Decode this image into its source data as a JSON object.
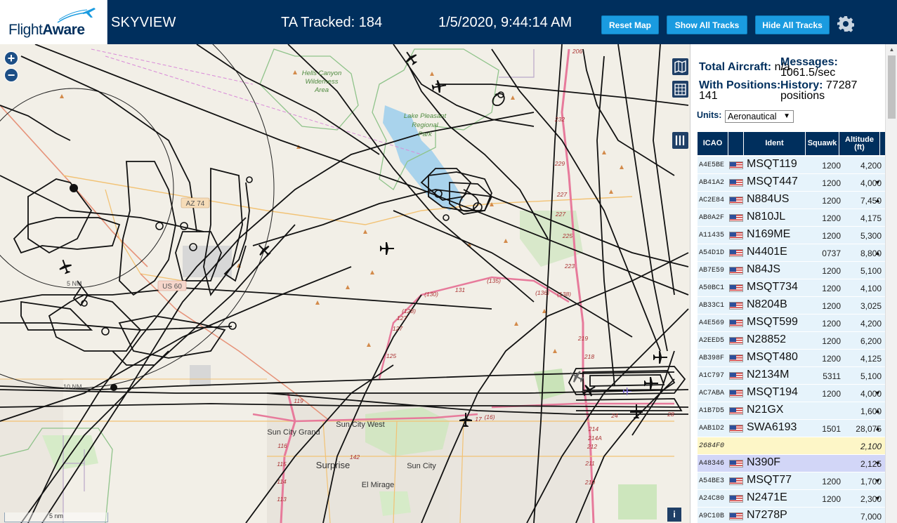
{
  "header": {
    "logo_flight": "Flight",
    "logo_aware": "Aware",
    "title": "SKYVIEW",
    "tracked": "TA Tracked: 184",
    "datetime": "1/5/2020, 9:44:14 AM",
    "buttons": {
      "reset": "Reset Map",
      "show_all": "Show All Tracks",
      "hide_all": "Hide All Tracks"
    },
    "colors": {
      "bar": "#002f5d",
      "button": "#1a9be0"
    }
  },
  "map": {
    "zoom_in": "+",
    "zoom_out": "−",
    "scale_label": "5 nm",
    "info": "i",
    "labels": {
      "hells_canyon_1": "Hells Canyon",
      "hells_canyon_2": "Wilderness",
      "hells_canyon_3": "Area",
      "lake_1": "Lake Pleasant",
      "lake_2": "Regional",
      "lake_3": "Park",
      "az74": "AZ 74",
      "us60": "US 60",
      "ring_5nm": "5 NM",
      "ring_10nm": "10 NM",
      "sun_city_grand": "Sun City Grand",
      "sun_city_west": "Sun City West",
      "sun_city": "Sun City",
      "surprise": "Surprise",
      "el_mirage": "El Mirage"
    },
    "route_markers": [
      "206",
      "232",
      "229",
      "227",
      "227",
      "225",
      "223",
      "219",
      "218",
      "214",
      "214A",
      "212",
      "211",
      "210",
      "116",
      "115",
      "114",
      "113",
      "119",
      "125",
      "127",
      "127",
      "(128)",
      "(130)",
      "131",
      "(135)",
      "(136)",
      "(138)",
      "142",
      "17",
      "(16)",
      "24",
      "28"
    ]
  },
  "panel": {
    "total_aircraft_label": "Total Aircraft:",
    "total_aircraft_value": "n/a",
    "with_positions_label": "With Positions:",
    "with_positions_value": "141",
    "messages_label": "Messages:",
    "messages_value": "1061.5/sec",
    "history_label": "History:",
    "history_value": "77287 positions",
    "units_label": "Units:",
    "units_value": "Aeronautical",
    "columns": {
      "icao": "ICAO",
      "ident": "Ident",
      "squawk": "Squawk",
      "altitude": "Altitude (ft)"
    },
    "rows": [
      {
        "icao": "A4E5BE",
        "ident": "MSQT119",
        "squawk": "1200",
        "alt": "4,200",
        "trend": "",
        "flag": true,
        "style": ""
      },
      {
        "icao": "AB41A2",
        "ident": "MSQT447",
        "squawk": "1200",
        "alt": "4,000",
        "trend": "▼",
        "flag": true,
        "style": ""
      },
      {
        "icao": "AC2E84",
        "ident": "N884US",
        "squawk": "1200",
        "alt": "7,450",
        "trend": "▲",
        "flag": true,
        "style": ""
      },
      {
        "icao": "AB0A2F",
        "ident": "N810JL",
        "squawk": "1200",
        "alt": "4,175",
        "trend": "",
        "flag": true,
        "style": ""
      },
      {
        "icao": "A11435",
        "ident": "N169ME",
        "squawk": "1200",
        "alt": "5,300",
        "trend": "",
        "flag": true,
        "style": ""
      },
      {
        "icao": "A54D1D",
        "ident": "N4401E",
        "squawk": "0737",
        "alt": "8,800",
        "trend": "▲",
        "flag": true,
        "style": ""
      },
      {
        "icao": "AB7E59",
        "ident": "N84JS",
        "squawk": "1200",
        "alt": "5,100",
        "trend": "",
        "flag": true,
        "style": ""
      },
      {
        "icao": "A50BC1",
        "ident": "MSQT734",
        "squawk": "1200",
        "alt": "4,100",
        "trend": "",
        "flag": true,
        "style": ""
      },
      {
        "icao": "AB33C1",
        "ident": "N8204B",
        "squawk": "1200",
        "alt": "3,025",
        "trend": "",
        "flag": true,
        "style": ""
      },
      {
        "icao": "A4E569",
        "ident": "MSQT599",
        "squawk": "1200",
        "alt": "4,200",
        "trend": "",
        "flag": true,
        "style": ""
      },
      {
        "icao": "A2EED5",
        "ident": "N28852",
        "squawk": "1200",
        "alt": "6,200",
        "trend": "",
        "flag": true,
        "style": ""
      },
      {
        "icao": "AB398F",
        "ident": "MSQT480",
        "squawk": "1200",
        "alt": "4,125",
        "trend": "",
        "flag": true,
        "style": ""
      },
      {
        "icao": "A1C797",
        "ident": "N2134M",
        "squawk": "5311",
        "alt": "5,100",
        "trend": "",
        "flag": true,
        "style": ""
      },
      {
        "icao": "AC7ABA",
        "ident": "MSQT194",
        "squawk": "1200",
        "alt": "4,000",
        "trend": "▼",
        "flag": true,
        "style": ""
      },
      {
        "icao": "A1B7D5",
        "ident": "N21GX",
        "squawk": "",
        "alt": "1,600",
        "trend": "▲",
        "flag": true,
        "style": ""
      },
      {
        "icao": "AAB1D2",
        "ident": "SWA6193",
        "squawk": "1501",
        "alt": "28,075",
        "trend": "▲",
        "flag": true,
        "style": ""
      },
      {
        "icao": "2684F0",
        "ident": "",
        "squawk": "",
        "alt": "2,100",
        "trend": "",
        "flag": false,
        "style": "yellow"
      },
      {
        "icao": "A48346",
        "ident": "N390F",
        "squawk": "",
        "alt": "2,125",
        "trend": "▼",
        "flag": true,
        "style": "selected"
      },
      {
        "icao": "A54BE3",
        "ident": "MSQT77",
        "squawk": "1200",
        "alt": "1,700",
        "trend": "▼",
        "flag": true,
        "style": ""
      },
      {
        "icao": "A24C80",
        "ident": "N2471E",
        "squawk": "1200",
        "alt": "2,300",
        "trend": "▼",
        "flag": true,
        "style": ""
      },
      {
        "icao": "A9C10B",
        "ident": "N7278P",
        "squawk": "",
        "alt": "7,000",
        "trend": "",
        "flag": true,
        "style": ""
      }
    ]
  }
}
